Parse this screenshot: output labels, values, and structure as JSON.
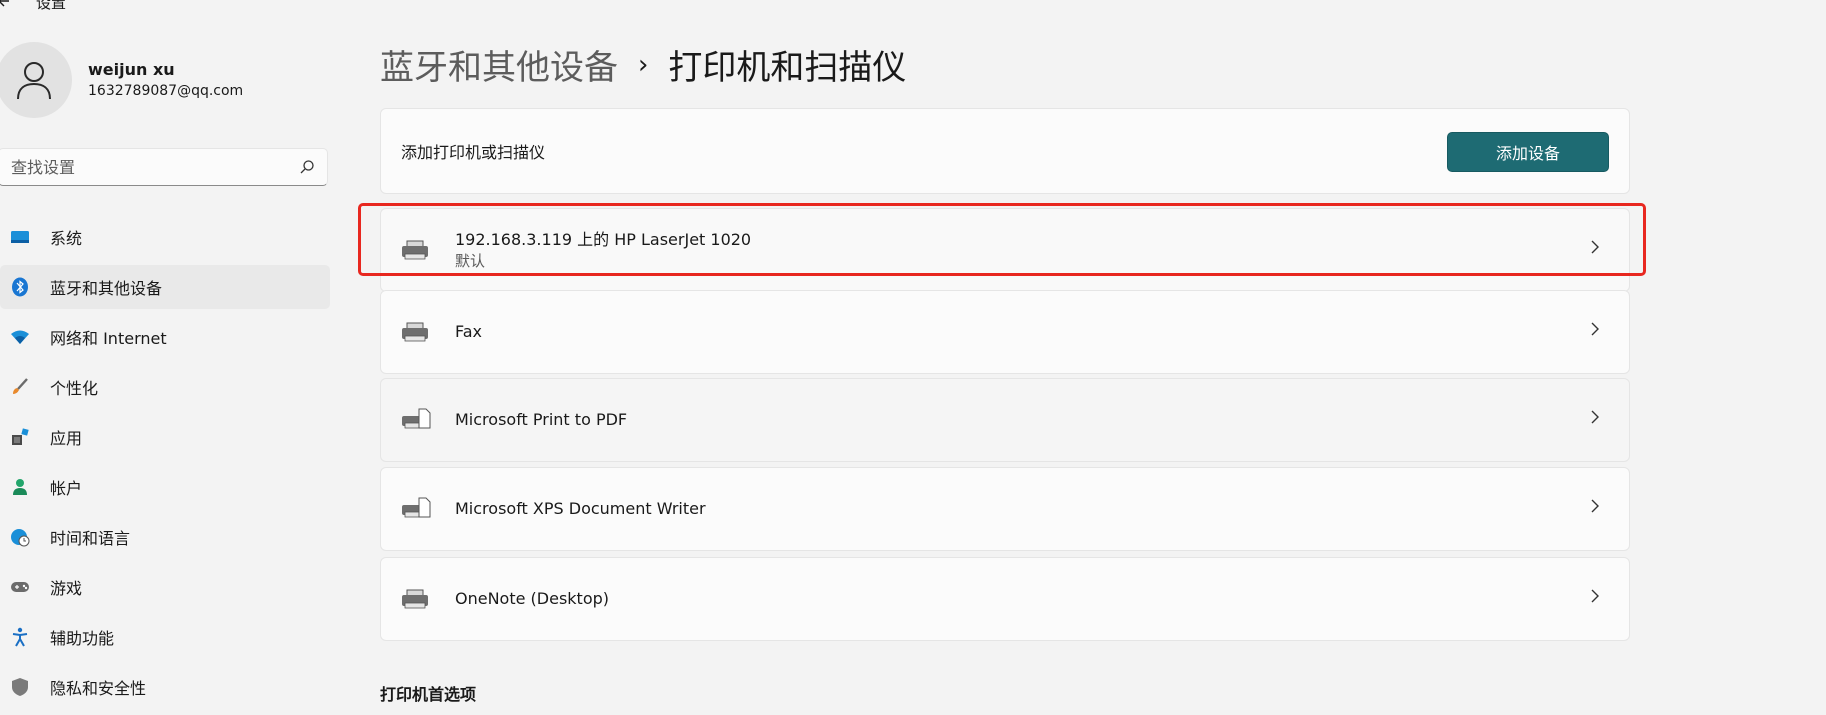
{
  "window": {
    "back_icon": "arrow-left",
    "title": "设置"
  },
  "user": {
    "name": "weijun xu",
    "email": "1632789087@qq.com",
    "avatar_icon": "person-icon"
  },
  "search": {
    "placeholder": "查找设置",
    "icon": "search-icon"
  },
  "nav": {
    "items": [
      {
        "label": "系统",
        "icon": "system-icon",
        "active": false
      },
      {
        "label": "蓝牙和其他设备",
        "icon": "bluetooth-icon",
        "active": true
      },
      {
        "label": "网络和 Internet",
        "icon": "wifi-icon",
        "active": false
      },
      {
        "label": "个性化",
        "icon": "brush-icon",
        "active": false
      },
      {
        "label": "应用",
        "icon": "apps-icon",
        "active": false
      },
      {
        "label": "帐户",
        "icon": "account-icon",
        "active": false
      },
      {
        "label": "时间和语言",
        "icon": "globe-clock-icon",
        "active": false
      },
      {
        "label": "游戏",
        "icon": "gamepad-icon",
        "active": false
      },
      {
        "label": "辅助功能",
        "icon": "accessibility-icon",
        "active": false
      },
      {
        "label": "隐私和安全性",
        "icon": "shield-icon",
        "active": false
      }
    ]
  },
  "breadcrumb": {
    "parent": "蓝牙和其他设备",
    "separator": "›",
    "current": "打印机和扫描仪"
  },
  "add_card": {
    "label": "添加打印机或扫描仪",
    "button": "添加设备"
  },
  "printers": [
    {
      "name": "192.168.3.119 上的 HP LaserJet 1020",
      "subtitle": "默认",
      "highlighted": true
    },
    {
      "name": "Fax",
      "subtitle": ""
    },
    {
      "name": "Microsoft Print to PDF",
      "subtitle": ""
    },
    {
      "name": "Microsoft XPS Document Writer",
      "subtitle": ""
    },
    {
      "name": "OneNote (Desktop)",
      "subtitle": ""
    }
  ],
  "section": {
    "heading": "打印机首选项"
  },
  "colors": {
    "accent": "#1e6b73",
    "highlight": "#e8271f",
    "background": "#f3f3f3"
  }
}
